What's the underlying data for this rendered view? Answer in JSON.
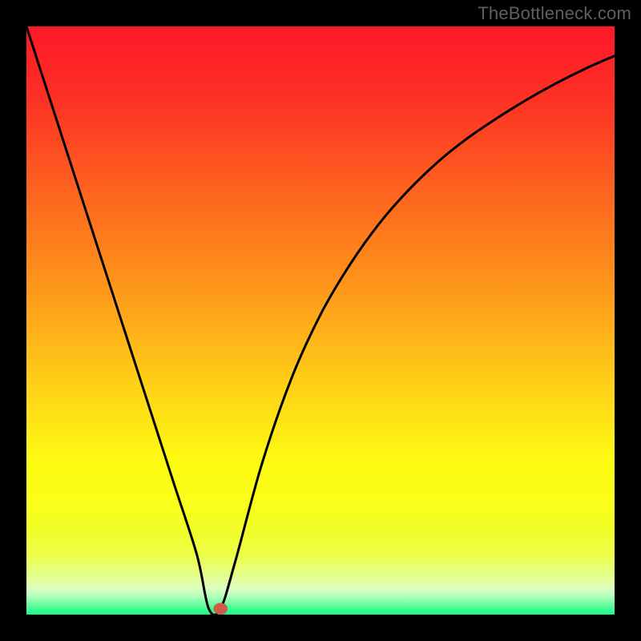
{
  "watermark": "TheBottleneck.com",
  "colors": {
    "frame": "#000000",
    "curve": "#000000",
    "marker": "#cf5b4a",
    "gradient_stops": [
      {
        "offset": 0.0,
        "color": "#fd1828"
      },
      {
        "offset": 0.12,
        "color": "#fd3025"
      },
      {
        "offset": 0.25,
        "color": "#fd5a20"
      },
      {
        "offset": 0.38,
        "color": "#fe821c"
      },
      {
        "offset": 0.5,
        "color": "#feaa19"
      },
      {
        "offset": 0.62,
        "color": "#fed416"
      },
      {
        "offset": 0.74,
        "color": "#fefb12"
      },
      {
        "offset": 0.81,
        "color": "#fbfe19"
      },
      {
        "offset": 0.86,
        "color": "#f0fe2a"
      },
      {
        "offset": 0.9,
        "color": "#ecfe4b"
      },
      {
        "offset": 0.93,
        "color": "#e5fe85"
      },
      {
        "offset": 0.955,
        "color": "#ddfebe"
      },
      {
        "offset": 0.97,
        "color": "#b0febc"
      },
      {
        "offset": 0.985,
        "color": "#5afd9a"
      },
      {
        "offset": 1.0,
        "color": "#14fd86"
      }
    ]
  },
  "chart_data": {
    "type": "line",
    "title": "",
    "xlabel": "",
    "ylabel": "",
    "xlim": [
      0,
      1
    ],
    "ylim": [
      0,
      1
    ],
    "series": [
      {
        "name": "bottleneck-curve",
        "x": [
          0.0,
          0.05,
          0.1,
          0.15,
          0.2,
          0.25,
          0.29,
          0.31,
          0.33,
          0.355,
          0.4,
          0.45,
          0.5,
          0.55,
          0.6,
          0.65,
          0.7,
          0.75,
          0.8,
          0.85,
          0.9,
          0.95,
          1.0
        ],
        "y": [
          1.0,
          0.845,
          0.69,
          0.535,
          0.38,
          0.225,
          0.101,
          0.01,
          0.01,
          0.09,
          0.255,
          0.4,
          0.51,
          0.595,
          0.665,
          0.722,
          0.77,
          0.81,
          0.844,
          0.875,
          0.903,
          0.928,
          0.95
        ]
      }
    ],
    "marker": {
      "x": 0.33,
      "y": 0.01,
      "rx": 0.012,
      "ry": 0.01
    }
  }
}
